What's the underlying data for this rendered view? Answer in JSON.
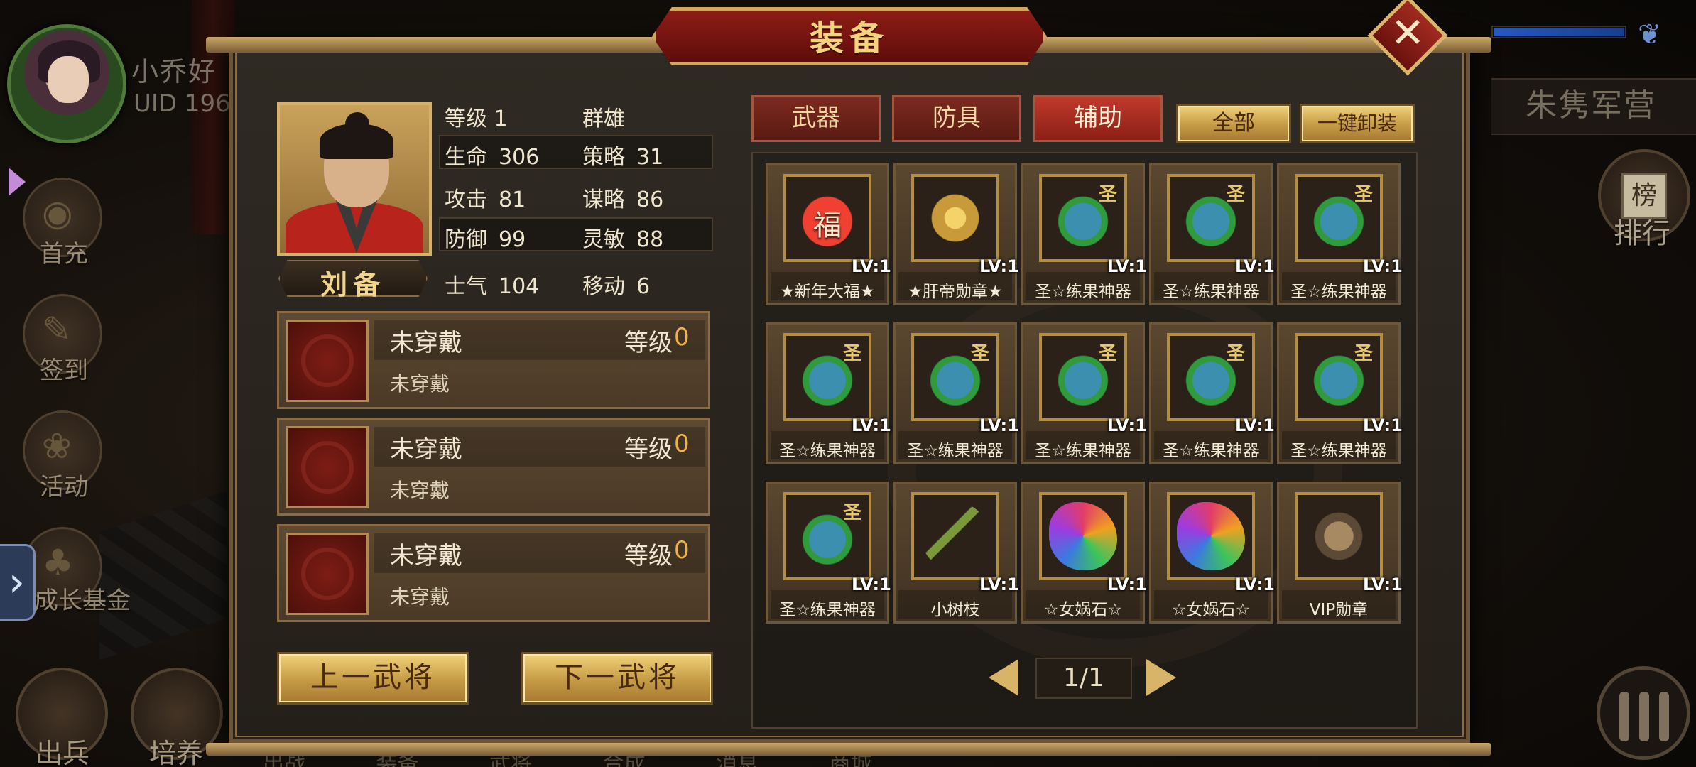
{
  "window": {
    "title": "装备"
  },
  "player": {
    "name": "小乔好",
    "uid": "UID 196"
  },
  "left_menu": [
    {
      "label": "首充",
      "icon": "gift-pouch-icon"
    },
    {
      "label": "签到",
      "icon": "scroll-brush-icon"
    },
    {
      "label": "活动",
      "icon": "flower-basket-icon"
    },
    {
      "label": "成长基金",
      "icon": "bonsai-icon"
    }
  ],
  "bottom_menu": [
    {
      "label": "出兵",
      "icon": "march-icon"
    },
    {
      "label": "培养",
      "icon": "train-icon"
    }
  ],
  "bottom_tabs_text": "出战 装备 武将 合成 消息 商城",
  "right_hud": {
    "camp": "朱隽军营",
    "rank_label": "排行",
    "rank_glyph": "榜"
  },
  "hero": {
    "name": "刘备",
    "level_label": "等级",
    "level": "1",
    "faction": "群雄",
    "stats": [
      {
        "label": "生命",
        "value": "306"
      },
      {
        "label": "策略",
        "value": "31"
      },
      {
        "label": "攻击",
        "value": "81"
      },
      {
        "label": "谋略",
        "value": "86"
      },
      {
        "label": "防御",
        "value": "99"
      },
      {
        "label": "灵敏",
        "value": "88"
      },
      {
        "label": "士气",
        "value": "104"
      },
      {
        "label": "移动",
        "value": "6"
      }
    ]
  },
  "slots": [
    {
      "title": "未穿戴",
      "level_label": "等级",
      "level": "0",
      "sub": "未穿戴"
    },
    {
      "title": "未穿戴",
      "level_label": "等级",
      "level": "0",
      "sub": "未穿戴"
    },
    {
      "title": "未穿戴",
      "level_label": "等级",
      "level": "0",
      "sub": "未穿戴"
    }
  ],
  "buttons": {
    "prev_hero": "上一武将",
    "next_hero": "下一武将",
    "filter_all": "全部",
    "unequip_all": "一键卸装"
  },
  "tabs": [
    {
      "label": "武器",
      "active": false
    },
    {
      "label": "防具",
      "active": false
    },
    {
      "label": "辅助",
      "active": true
    }
  ],
  "items": [
    {
      "name": "★新年大福★",
      "level": "LV:1",
      "art": "bag",
      "glyph": "福",
      "badge": ""
    },
    {
      "name": "★肝帝勋章★",
      "level": "LV:1",
      "art": "medal",
      "glyph": "",
      "badge": ""
    },
    {
      "name": "圣☆练果神器",
      "level": "LV:1",
      "art": "cauldron",
      "glyph": "",
      "badge": "圣"
    },
    {
      "name": "圣☆练果神器",
      "level": "LV:1",
      "art": "cauldron",
      "glyph": "",
      "badge": "圣"
    },
    {
      "name": "圣☆练果神器",
      "level": "LV:1",
      "art": "cauldron",
      "glyph": "",
      "badge": "圣"
    },
    {
      "name": "圣☆练果神器",
      "level": "LV:1",
      "art": "cauldron",
      "glyph": "",
      "badge": "圣"
    },
    {
      "name": "圣☆练果神器",
      "level": "LV:1",
      "art": "cauldron",
      "glyph": "",
      "badge": "圣"
    },
    {
      "name": "圣☆练果神器",
      "level": "LV:1",
      "art": "cauldron",
      "glyph": "",
      "badge": "圣"
    },
    {
      "name": "圣☆练果神器",
      "level": "LV:1",
      "art": "cauldron",
      "glyph": "",
      "badge": "圣"
    },
    {
      "name": "圣☆练果神器",
      "level": "LV:1",
      "art": "cauldron",
      "glyph": "",
      "badge": "圣"
    },
    {
      "name": "圣☆练果神器",
      "level": "LV:1",
      "art": "cauldron",
      "glyph": "",
      "badge": "圣"
    },
    {
      "name": "小树枝",
      "level": "LV:1",
      "art": "twig",
      "glyph": "",
      "badge": ""
    },
    {
      "name": "☆女娲石☆",
      "level": "LV:1",
      "art": "gem",
      "glyph": "",
      "badge": ""
    },
    {
      "name": "☆女娲石☆",
      "level": "LV:1",
      "art": "gem",
      "glyph": "",
      "badge": ""
    },
    {
      "name": "VIP勋章",
      "level": "LV:1",
      "art": "vip",
      "glyph": "",
      "badge": ""
    }
  ],
  "pager": {
    "text": "1/1"
  },
  "colors": {
    "accent_gold": "#f0b24a",
    "tab_red": "#c0392b",
    "frame_brown": "#6d5437"
  }
}
